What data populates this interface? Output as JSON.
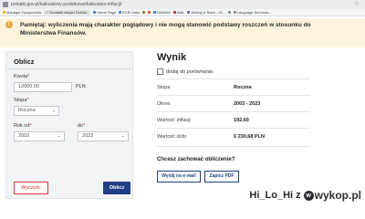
{
  "browser": {
    "url": "podatki.gov.pl/kalkulatory-podatkowe/kalkulator-inflacji/"
  },
  "bookmarks": [
    {
      "label": "Manager Dysponenta",
      "color": "#f0b400",
      "chip": false
    },
    {
      "label": "Dodatek wegiel Dziedz..",
      "color": "#c8ccd2",
      "chip": true
    },
    {
      "label": "Home Page",
      "color": "#4a7bd4",
      "chip": false
    },
    {
      "label": "ECB Links",
      "color": "#4a7bd4",
      "chip": false
    },
    {
      "label": "",
      "color": "#6b8e23",
      "chip": false
    },
    {
      "label": "",
      "color": "#d84b20",
      "chip": false
    },
    {
      "label": "DANWA",
      "color": "#2e77d0",
      "chip": false
    },
    {
      "label": "NAK",
      "color": "#c0392b",
      "chip": false
    },
    {
      "label": "Joining a Team - Gl...",
      "color": "#6a5acd",
      "chip": false
    },
    {
      "label": "",
      "color": "#888888",
      "chip": false
    },
    {
      "label": "Language Services...",
      "color": "#888888",
      "chip": false
    }
  ],
  "notice": {
    "text": "Pamiętaj: wyliczenia mają charakter poglądowy i nie mogą stanowić podstawy roszczeń w stosunku do Ministerstwa Finansów."
  },
  "calc": {
    "title": "Oblicz",
    "amount_label": "Kwota",
    "amount_value": "12000,00",
    "amount_unit": "PLN",
    "rate_label": "Stopa",
    "rate_value": "Roczna",
    "from_label": "Rok od",
    "from_value": "2003",
    "to_label": "do",
    "to_value": "2023",
    "required_mark": "*",
    "clear_button": "Wyczyść",
    "calc_button": "Oblicz"
  },
  "result": {
    "title": "Wynik",
    "compare_label": "dodaj do porównania",
    "rows": [
      {
        "key": "Stopa",
        "value": "Roczna"
      },
      {
        "key": "Okres",
        "value": "2003 - 2023"
      },
      {
        "key": "Wartość inflacji",
        "value": "192,60"
      },
      {
        "key": "Wartość dóbr",
        "value": "6 230,68 PLN"
      }
    ],
    "save_question": "Chcesz zachować obliczenie?",
    "email_button": "Wyślij na e-mail",
    "pdf_button": "Zapisz PDF"
  },
  "watermark": {
    "user": "Hi_Lo_Hi z",
    "logo_text": "wykop.pl",
    "logo_initial": "w"
  }
}
